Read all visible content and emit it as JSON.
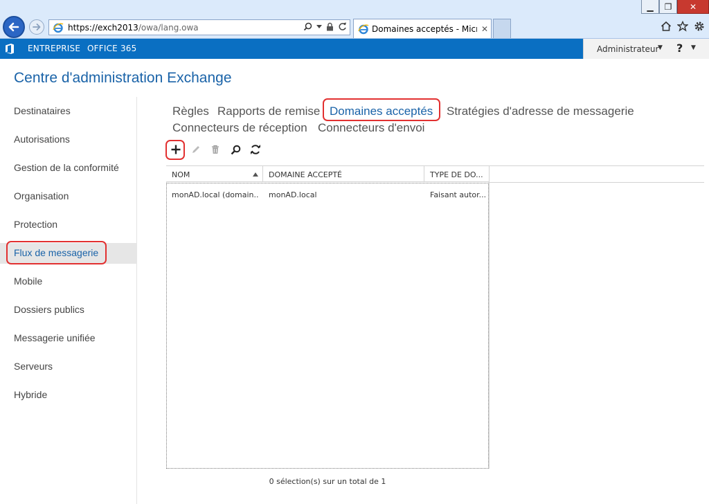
{
  "browser": {
    "url_scheme": "https://",
    "url_host": "exch2013",
    "url_path": "/owa/lang.owa",
    "tab_title": "Domaines acceptés - Micro...",
    "tab_close": "✕",
    "window_buttons": {
      "minimize": "▁",
      "restore": "❐",
      "close": "✕"
    }
  },
  "appbar": {
    "nav": [
      "ENTREPRISE",
      "OFFICE 365"
    ],
    "user": "Administrateur",
    "help": "?"
  },
  "page_title": "Centre d'administration Exchange",
  "sidebar": {
    "items": [
      "Destinataires",
      "Autorisations",
      "Gestion de la conformité",
      "Organisation",
      "Protection",
      "Flux de messagerie",
      "Mobile",
      "Dossiers publics",
      "Messagerie unifiée",
      "Serveurs",
      "Hybride"
    ],
    "selected": "Flux de messagerie"
  },
  "subnav": {
    "row1": [
      "Règles",
      "Rapports de remise",
      "Domaines acceptés",
      "Stratégies d'adresse de messagerie"
    ],
    "row2": [
      "Connecteurs de réception",
      "Connecteurs d'envoi"
    ],
    "active": "Domaines acceptés"
  },
  "grid": {
    "columns": [
      "NOM",
      "DOMAINE ACCEPTÉ",
      "TYPE DE DO..."
    ],
    "sorted_column": "NOM",
    "rows": [
      {
        "nom": "monAD.local (domain...",
        "domaine": "monAD.local",
        "type": "Faisant autor..."
      }
    ]
  },
  "status": "0 sélection(s) sur un total de 1",
  "colors": {
    "accent": "#1a63a8",
    "appbar": "#0a6fc2",
    "highlight": "#e23030"
  }
}
